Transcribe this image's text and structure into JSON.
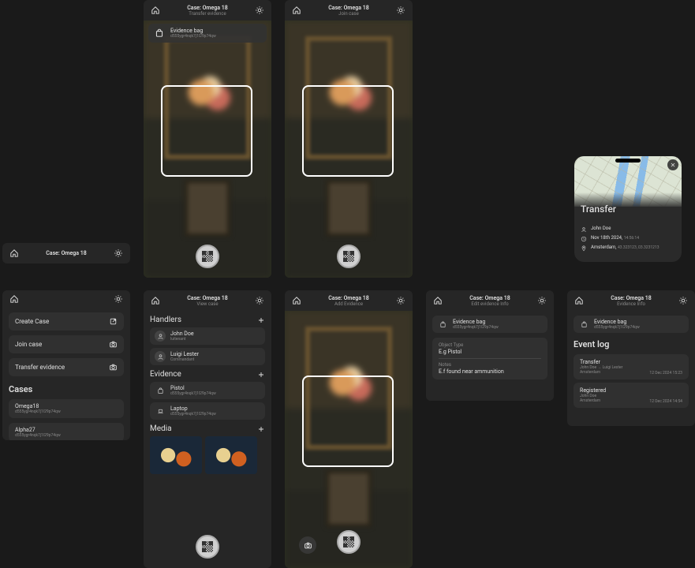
{
  "case_label": "Case: Omega 18",
  "screens": {
    "transfer_scan": {
      "subtitle": "Transfer evidence",
      "evidence": {
        "name": "Evidence bag",
        "hash": "d555ygr4nqk7j1l29p74qw"
      }
    },
    "join_scan": {
      "subtitle": "Join case"
    },
    "add_evidence_scan": {
      "subtitle": "Add Evidence"
    }
  },
  "cases_screen": {
    "actions": {
      "create": "Create Case",
      "join": "Join case",
      "transfer": "Transfer evidence"
    },
    "section": "Cases",
    "items": [
      {
        "name": "Omega18",
        "hash": "d555ygr4nqk7j1l29p74qw"
      },
      {
        "name": "Alpha27",
        "hash": "d555ygr4nqk7j1l29p74qw"
      }
    ]
  },
  "view_case": {
    "subtitle": "View case",
    "handlers_label": "Handlers",
    "handlers": [
      {
        "name": "John Doe",
        "role": "luitenant"
      },
      {
        "name": "Luigi Lester",
        "role": "Commandant"
      }
    ],
    "evidence_label": "Evidence",
    "evidence": [
      {
        "name": "Pistol",
        "hash": "d555ygr4nqk7j1l29p74qw"
      },
      {
        "name": "Laptop",
        "hash": "d555ygr4nqk7j1l29p74qw"
      }
    ],
    "media_label": "Media"
  },
  "edit_info": {
    "subtitle": "Edit evidence Info",
    "evidence": {
      "name": "Evidence bag",
      "hash": "d555ygr4nqk7j1l29p74qw"
    },
    "object_type_label": "Object Type",
    "object_type_value": "E.g Pistol",
    "notes_label": "Notes",
    "notes_value": "E.f found near ammunition"
  },
  "evidence_log": {
    "subtitle": "Evidence Info",
    "evidence": {
      "name": "Evidence bag",
      "hash": "d555ygr4nqk7j1l29p74qw"
    },
    "heading": "Event log",
    "events": [
      {
        "title": "Transfer",
        "line": "John Doe → Luigi Lester",
        "place": "Amsterdam",
        "time": "12 Dec 2024 15:23"
      },
      {
        "title": "Registered",
        "line": "John Doe",
        "place": "Amsterdam",
        "time": "12 Dec 2024 14:54"
      }
    ]
  },
  "transfer_popup": {
    "title": "Transfer",
    "person": "John Doe",
    "date": "Nov 18th 2024,",
    "date_time": "14:56:14",
    "place": "Amsterdam,",
    "coords": "43.323123, 03.3231213"
  }
}
